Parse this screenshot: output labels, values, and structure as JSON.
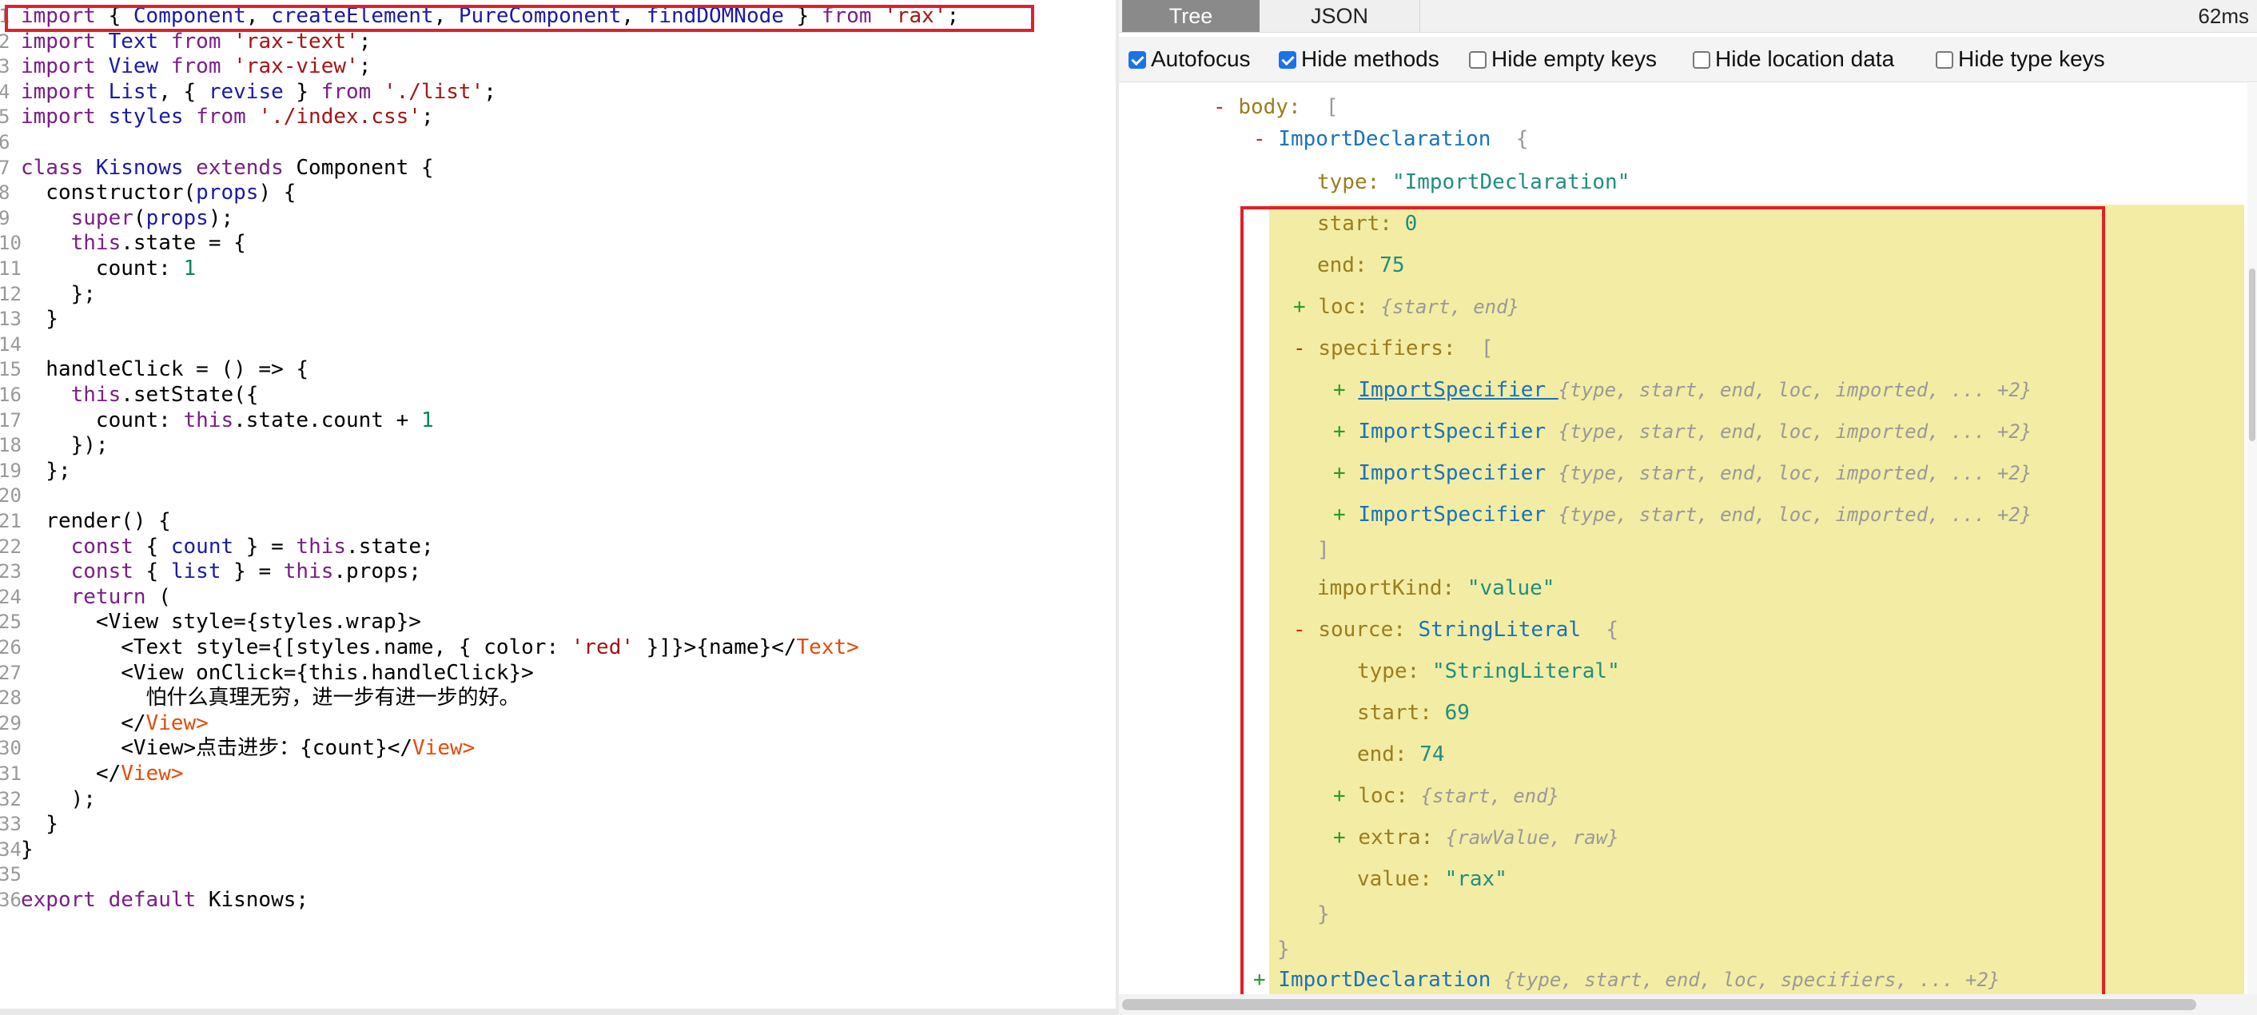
{
  "editor": {
    "lines": [
      {
        "num": "1",
        "tokens": [
          {
            "c": "kw",
            "t": "import "
          },
          {
            "c": "plain",
            "t": "{ "
          },
          {
            "c": "kb",
            "t": "Component"
          },
          {
            "c": "plain",
            "t": ", "
          },
          {
            "c": "kb",
            "t": "createElement"
          },
          {
            "c": "plain",
            "t": ", "
          },
          {
            "c": "kb",
            "t": "PureComponent"
          },
          {
            "c": "plain",
            "t": ", "
          },
          {
            "c": "kb",
            "t": "findDOMNode"
          },
          {
            "c": "plain",
            "t": " } "
          },
          {
            "c": "kw",
            "t": "from "
          },
          {
            "c": "str",
            "t": "'rax'"
          },
          {
            "c": "plain",
            "t": ";"
          }
        ]
      },
      {
        "num": "2",
        "tokens": [
          {
            "c": "kw",
            "t": "import "
          },
          {
            "c": "kb",
            "t": "Text "
          },
          {
            "c": "kw",
            "t": "from "
          },
          {
            "c": "str",
            "t": "'rax-text'"
          },
          {
            "c": "plain",
            "t": ";"
          }
        ]
      },
      {
        "num": "3",
        "tokens": [
          {
            "c": "kw",
            "t": "import "
          },
          {
            "c": "kb",
            "t": "View "
          },
          {
            "c": "kw",
            "t": "from "
          },
          {
            "c": "str",
            "t": "'rax-view'"
          },
          {
            "c": "plain",
            "t": ";"
          }
        ]
      },
      {
        "num": "4",
        "tokens": [
          {
            "c": "kw",
            "t": "import "
          },
          {
            "c": "kb",
            "t": "List"
          },
          {
            "c": "plain",
            "t": ", { "
          },
          {
            "c": "kb",
            "t": "revise"
          },
          {
            "c": "plain",
            "t": " } "
          },
          {
            "c": "kw",
            "t": "from "
          },
          {
            "c": "str",
            "t": "'./list'"
          },
          {
            "c": "plain",
            "t": ";"
          }
        ]
      },
      {
        "num": "5",
        "tokens": [
          {
            "c": "kw",
            "t": "import "
          },
          {
            "c": "kb",
            "t": "styles "
          },
          {
            "c": "kw",
            "t": "from "
          },
          {
            "c": "str",
            "t": "'./index.css'"
          },
          {
            "c": "plain",
            "t": ";"
          }
        ]
      },
      {
        "num": "6",
        "tokens": []
      },
      {
        "num": "7",
        "tokens": [
          {
            "c": "kw",
            "t": "class "
          },
          {
            "c": "kb",
            "t": "Kisnows "
          },
          {
            "c": "kw",
            "t": "extends "
          },
          {
            "c": "plain",
            "t": "Component {"
          }
        ]
      },
      {
        "num": "8",
        "tokens": [
          {
            "c": "plain",
            "t": "  constructor("
          },
          {
            "c": "kb",
            "t": "props"
          },
          {
            "c": "plain",
            "t": ") {"
          }
        ]
      },
      {
        "num": "9",
        "tokens": [
          {
            "c": "plain",
            "t": "    "
          },
          {
            "c": "kw",
            "t": "super"
          },
          {
            "c": "plain",
            "t": "("
          },
          {
            "c": "kb",
            "t": "props"
          },
          {
            "c": "plain",
            "t": ");"
          }
        ]
      },
      {
        "num": "10",
        "tokens": [
          {
            "c": "plain",
            "t": "    "
          },
          {
            "c": "kw",
            "t": "this"
          },
          {
            "c": "plain",
            "t": ".state = {"
          }
        ]
      },
      {
        "num": "11",
        "tokens": [
          {
            "c": "plain",
            "t": "      count: "
          },
          {
            "c": "num",
            "t": "1"
          }
        ]
      },
      {
        "num": "12",
        "tokens": [
          {
            "c": "plain",
            "t": "    };"
          }
        ]
      },
      {
        "num": "13",
        "tokens": [
          {
            "c": "plain",
            "t": "  }"
          }
        ]
      },
      {
        "num": "14",
        "tokens": []
      },
      {
        "num": "15",
        "tokens": [
          {
            "c": "plain",
            "t": "  handleClick = () => {"
          }
        ]
      },
      {
        "num": "16",
        "tokens": [
          {
            "c": "plain",
            "t": "    "
          },
          {
            "c": "kw",
            "t": "this"
          },
          {
            "c": "plain",
            "t": ".setState({"
          }
        ]
      },
      {
        "num": "17",
        "tokens": [
          {
            "c": "plain",
            "t": "      count: "
          },
          {
            "c": "kw",
            "t": "this"
          },
          {
            "c": "plain",
            "t": ".state.count + "
          },
          {
            "c": "num",
            "t": "1"
          }
        ]
      },
      {
        "num": "18",
        "tokens": [
          {
            "c": "plain",
            "t": "    });"
          }
        ]
      },
      {
        "num": "19",
        "tokens": [
          {
            "c": "plain",
            "t": "  };"
          }
        ]
      },
      {
        "num": "20",
        "tokens": []
      },
      {
        "num": "21",
        "tokens": [
          {
            "c": "plain",
            "t": "  render() {"
          }
        ]
      },
      {
        "num": "22",
        "tokens": [
          {
            "c": "plain",
            "t": "    "
          },
          {
            "c": "kw",
            "t": "const "
          },
          {
            "c": "plain",
            "t": "{ "
          },
          {
            "c": "kb",
            "t": "count"
          },
          {
            "c": "plain",
            "t": " } = "
          },
          {
            "c": "kw",
            "t": "this"
          },
          {
            "c": "plain",
            "t": ".state;"
          }
        ]
      },
      {
        "num": "23",
        "tokens": [
          {
            "c": "plain",
            "t": "    "
          },
          {
            "c": "kw",
            "t": "const "
          },
          {
            "c": "plain",
            "t": "{ "
          },
          {
            "c": "kb",
            "t": "list"
          },
          {
            "c": "plain",
            "t": " } = "
          },
          {
            "c": "kw",
            "t": "this"
          },
          {
            "c": "plain",
            "t": ".props;"
          }
        ]
      },
      {
        "num": "24",
        "tokens": [
          {
            "c": "plain",
            "t": "    "
          },
          {
            "c": "kw",
            "t": "return "
          },
          {
            "c": "plain",
            "t": "("
          }
        ]
      },
      {
        "num": "25",
        "tokens": [
          {
            "c": "plain",
            "t": "      <View style={styles.wrap}>"
          }
        ]
      },
      {
        "num": "26",
        "tokens": [
          {
            "c": "plain",
            "t": "        <Text style={[styles.name, { color: "
          },
          {
            "c": "str",
            "t": "'red'"
          },
          {
            "c": "plain",
            "t": " }]}>{name}</"
          },
          {
            "c": "tagc",
            "t": "Text"
          },
          {
            "c": "tagc",
            "t": ">"
          }
        ]
      },
      {
        "num": "27",
        "tokens": [
          {
            "c": "plain",
            "t": "        <View onClick={this.handleClick}>"
          }
        ]
      },
      {
        "num": "28",
        "tokens": [
          {
            "c": "plain",
            "t": "          怕什么真理无穷，进一步有进一步的好。"
          }
        ]
      },
      {
        "num": "29",
        "tokens": [
          {
            "c": "plain",
            "t": "        </"
          },
          {
            "c": "tagc",
            "t": "View"
          },
          {
            "c": "tagc",
            "t": ">"
          }
        ]
      },
      {
        "num": "30",
        "tokens": [
          {
            "c": "plain",
            "t": "        <View>点击进步：{count}</"
          },
          {
            "c": "tagc",
            "t": "View"
          },
          {
            "c": "tagc",
            "t": ">"
          }
        ]
      },
      {
        "num": "31",
        "tokens": [
          {
            "c": "plain",
            "t": "      </"
          },
          {
            "c": "tagc",
            "t": "View"
          },
          {
            "c": "tagc",
            "t": ">"
          }
        ]
      },
      {
        "num": "32",
        "tokens": [
          {
            "c": "plain",
            "t": "    );"
          }
        ]
      },
      {
        "num": "33",
        "tokens": [
          {
            "c": "plain",
            "t": "  }"
          }
        ]
      },
      {
        "num": "34",
        "tokens": [
          {
            "c": "plain",
            "t": "}"
          }
        ]
      },
      {
        "num": "35",
        "tokens": []
      },
      {
        "num": "36",
        "tokens": [
          {
            "c": "kw",
            "t": "export "
          },
          {
            "c": "kw",
            "t": "default "
          },
          {
            "c": "plain",
            "t": "Kisnows;"
          }
        ]
      }
    ]
  },
  "panel": {
    "tabs": {
      "tree": "Tree",
      "json": "JSON"
    },
    "timing": "62ms",
    "options": {
      "autofocus": {
        "label": "Autofocus",
        "checked": true
      },
      "hide_methods": {
        "label": "Hide methods",
        "checked": true
      },
      "hide_empty": {
        "label": "Hide empty keys",
        "checked": false
      },
      "hide_location": {
        "label": "Hide location data",
        "checked": false
      },
      "hide_type": {
        "label": "Hide type keys",
        "checked": false
      }
    },
    "tree": {
      "body_key": "body",
      "body_open": "[",
      "decl1": {
        "name": "ImportDeclaration",
        "open": "{",
        "type_key": "type",
        "type_val": "\"ImportDeclaration\"",
        "start_key": "start",
        "start_val": "0",
        "end_key": "end",
        "end_val": "75",
        "loc_key": "loc",
        "loc_summary": "{start, end}",
        "spec_key": "specifiers",
        "spec_open": "[",
        "specifiers": [
          {
            "name": "ImportSpecifier ",
            "summary": "{type, start, end, loc, imported, ... +2}"
          },
          {
            "name": "ImportSpecifier",
            "summary": "{type, start, end, loc, imported, ... +2}"
          },
          {
            "name": "ImportSpecifier",
            "summary": "{type, start, end, loc, imported, ... +2}"
          },
          {
            "name": "ImportSpecifier",
            "summary": "{type, start, end, loc, imported, ... +2}"
          }
        ],
        "spec_close": "]",
        "importkind_key": "importKind",
        "importkind_val": "\"value\"",
        "source_key": "source",
        "source_type": "StringLiteral",
        "source_open": "{",
        "src_type_key": "type",
        "src_type_val": "\"StringLiteral\"",
        "src_start_key": "start",
        "src_start_val": "69",
        "src_end_key": "end",
        "src_end_val": "74",
        "src_loc_key": "loc",
        "src_loc_summary": "{start, end}",
        "src_extra_key": "extra",
        "src_extra_summary": "{rawValue, raw}",
        "src_value_key": "value",
        "src_value_val": "\"rax\"",
        "source_close": "}",
        "close": "}"
      },
      "decl2": {
        "name": "ImportDeclaration",
        "summary": "{type, start, end, loc, specifiers, ... +2}"
      },
      "toggle_minus": "-",
      "toggle_plus": "+",
      "colon": ": "
    }
  }
}
